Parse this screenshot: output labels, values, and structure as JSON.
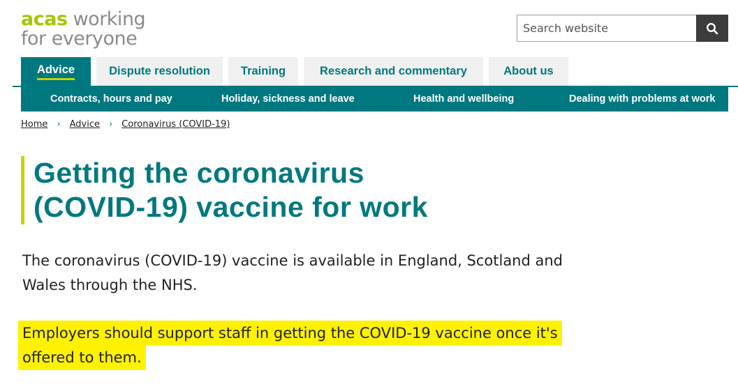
{
  "logo": {
    "brand": "acas",
    "line1_rest": " working",
    "line2": "for everyone"
  },
  "search": {
    "placeholder": "Search website",
    "icon": "search-icon"
  },
  "tabs": [
    {
      "label": "Advice",
      "active": true
    },
    {
      "label": "Dispute resolution",
      "active": false
    },
    {
      "label": "Training",
      "active": false
    },
    {
      "label": "Research and commentary",
      "active": false
    },
    {
      "label": "About us",
      "active": false
    }
  ],
  "subnav": [
    {
      "label": "Contracts, hours and pay"
    },
    {
      "label": "Holiday, sickness and leave"
    },
    {
      "label": "Health and wellbeing"
    },
    {
      "label": "Dealing with problems at work"
    }
  ],
  "breadcrumb": [
    {
      "label": "Home"
    },
    {
      "label": "Advice"
    },
    {
      "label": "Coronavirus (COVID-19)"
    }
  ],
  "page": {
    "title_line1": "Getting the coronavirus",
    "title_line2": "(COVID-19) vaccine for work",
    "intro": "The coronavirus (COVID-19) vaccine is available in England, Scotland and Wales through the NHS.",
    "highlight": "Employers should support staff in getting the COVID-19 vaccine once it's offered to them."
  },
  "colors": {
    "brand_teal": "#00787f",
    "brand_lime": "#c7d300",
    "highlight": "#fff200"
  }
}
